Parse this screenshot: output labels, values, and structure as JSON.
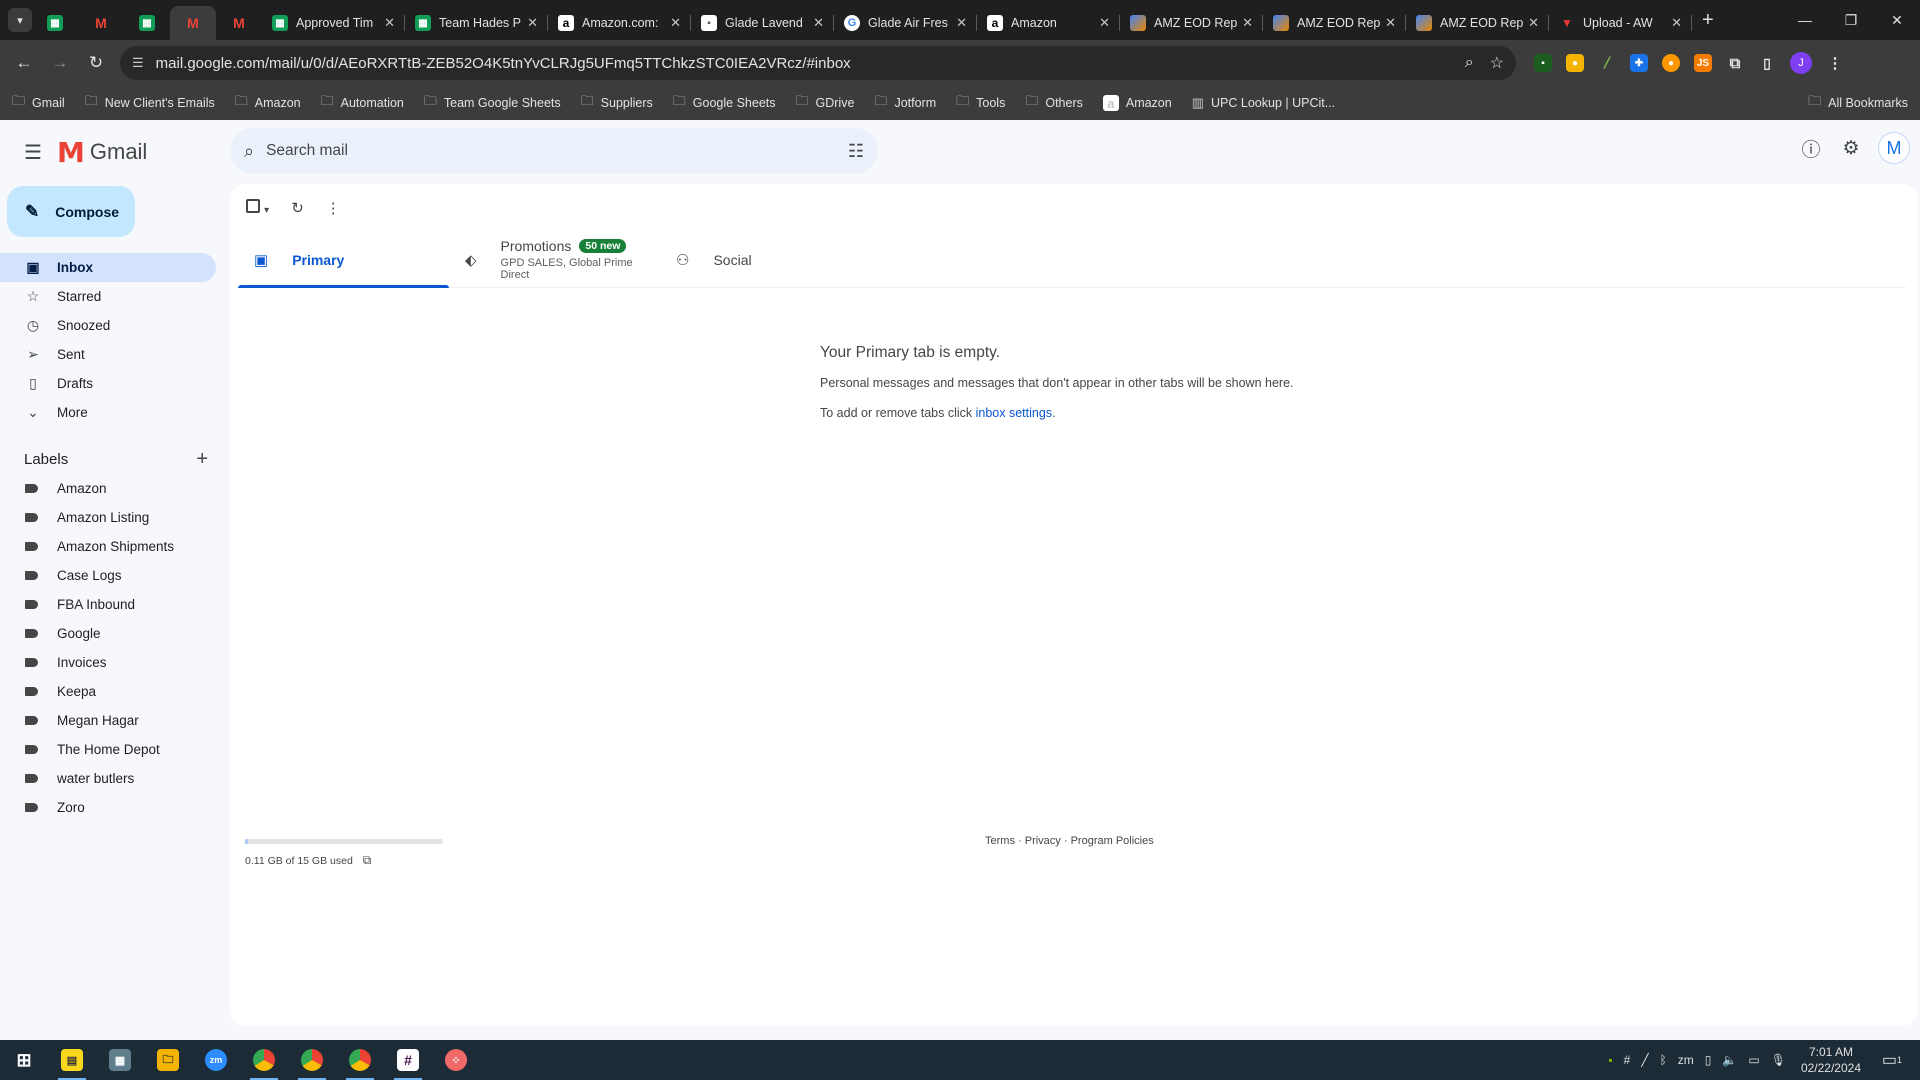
{
  "browser": {
    "tabs": [
      {
        "title": "Approved Tim",
        "icon": "sheets-icon"
      },
      {
        "title": "Team Hades P",
        "icon": "sheets-icon"
      },
      {
        "title": "Amazon.com:",
        "icon": "amazon-icon"
      },
      {
        "title": "Glade Lavend",
        "icon": "glade-icon"
      },
      {
        "title": "Glade Air Fres",
        "icon": "google-icon"
      },
      {
        "title": "Amazon",
        "icon": "amazon-icon"
      },
      {
        "title": "AMZ EOD Rep",
        "icon": "amz-eod-icon"
      },
      {
        "title": "AMZ EOD Rep",
        "icon": "amz-eod-icon"
      },
      {
        "title": "AMZ EOD Rep",
        "icon": "amz-eod-icon"
      },
      {
        "title": "Upload - AW",
        "icon": "upload-icon"
      }
    ],
    "url": "mail.google.com/mail/u/0/d/AEoRXRTtB-ZEB52O4K5tnYvCLRJg5UFmq5TTChkzSTC0IEA2VRcz/#inbox",
    "profile_initial": "J",
    "bookmarks": [
      {
        "label": "Gmail",
        "icon": "folder-icon"
      },
      {
        "label": "New Client's Emails",
        "icon": "folder-icon"
      },
      {
        "label": "Amazon",
        "icon": "folder-icon"
      },
      {
        "label": "Automation",
        "icon": "folder-icon"
      },
      {
        "label": "Team Google Sheets",
        "icon": "folder-icon"
      },
      {
        "label": "Suppliers",
        "icon": "folder-icon"
      },
      {
        "label": "Google Sheets",
        "icon": "folder-icon"
      },
      {
        "label": "GDrive",
        "icon": "folder-icon"
      },
      {
        "label": "Jotform",
        "icon": "folder-icon"
      },
      {
        "label": "Tools",
        "icon": "folder-icon"
      },
      {
        "label": "Others",
        "icon": "folder-icon"
      },
      {
        "label": "Amazon",
        "icon": "amazon-icon"
      },
      {
        "label": "UPC Lookup | UPCit...",
        "icon": "barcode-icon"
      }
    ],
    "all_bookmarks": "All Bookmarks"
  },
  "gmail": {
    "logo_text": "Gmail",
    "search_placeholder": "Search mail",
    "account_initial": "M",
    "compose_label": "Compose",
    "nav": [
      {
        "label": "Inbox",
        "icon": "inbox-icon",
        "active": true
      },
      {
        "label": "Starred",
        "icon": "star-icon"
      },
      {
        "label": "Snoozed",
        "icon": "clock-icon"
      },
      {
        "label": "Sent",
        "icon": "send-icon"
      },
      {
        "label": "Drafts",
        "icon": "draft-icon"
      },
      {
        "label": "More",
        "icon": "chevron-down-icon"
      }
    ],
    "labels_title": "Labels",
    "labels": [
      "Amazon",
      "Amazon Listing",
      "Amazon Shipments",
      "Case Logs",
      "FBA Inbound",
      "Google",
      "Invoices",
      "Keepa",
      "Megan Hagar",
      "The Home Depot",
      "water butlers",
      "Zoro"
    ],
    "tabs": {
      "primary": "Primary",
      "promotions": "Promotions",
      "promotions_badge": "50 new",
      "promotions_senders": "GPD SALES, Global Prime Direct",
      "social": "Social"
    },
    "empty": {
      "title": "Your Primary tab is empty.",
      "line1": "Personal messages and messages that don't appear in other tabs will be shown here.",
      "line2_prefix": "To add or remove tabs click ",
      "line2_link": "inbox settings",
      "line2_suffix": "."
    },
    "storage": {
      "text": "0.11 GB of 15 GB used",
      "fraction_used": 0.0073
    },
    "footer": {
      "terms": "Terms",
      "privacy": "Privacy",
      "policies": "Program Policies",
      "sep": " · "
    }
  },
  "taskbar": {
    "time": "7:01 AM",
    "date": "02/22/2024",
    "notification_count": "1"
  },
  "colors": {
    "accent": "#0b57d0",
    "compose_bg": "#c2e7ff",
    "inbox_active": "#d3e3fd",
    "badge_green": "#188038"
  }
}
